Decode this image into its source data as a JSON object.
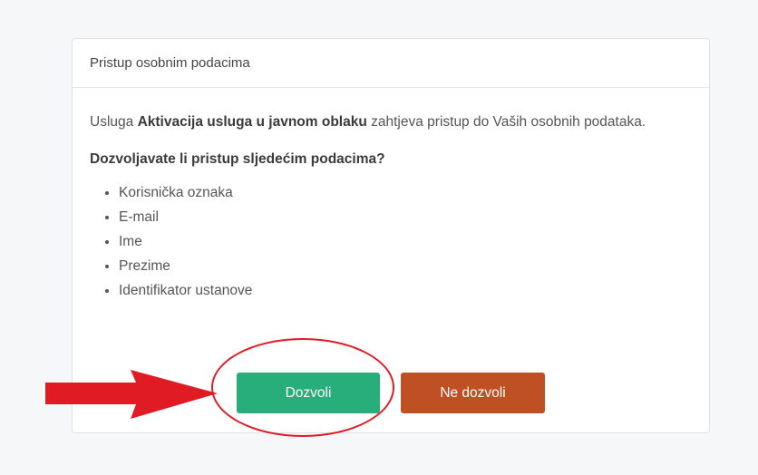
{
  "card": {
    "header_title": "Pristup osobnim podacima",
    "intro_prefix": "Usluga ",
    "service_name": "Aktivacija usluga u javnom oblaku",
    "intro_suffix": " zahtjeva pristup do Vaših osobnih podataka.",
    "question": "Dozvoljavate li pristup sljedećim podacima?",
    "fields": [
      "Korisnička oznaka",
      "E-mail",
      "Ime",
      "Prezime",
      "Identifikator ustanove"
    ]
  },
  "actions": {
    "allow_label": "Dozvoli",
    "deny_label": "Ne dozvoli",
    "allow_color": "#27ae7a",
    "deny_color": "#bf5024"
  },
  "annotation": {
    "marker_color": "#e01b24"
  }
}
